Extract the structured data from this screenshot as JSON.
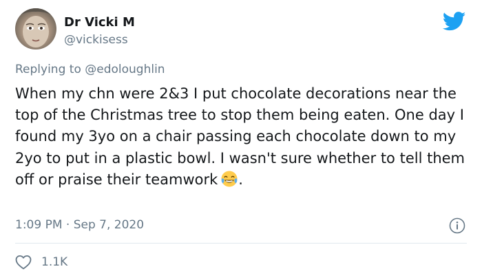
{
  "author": {
    "display_name": "Dr Vicki M",
    "handle": "@vickisess"
  },
  "reply": {
    "prefix": "Replying to ",
    "mention": "@edoloughlin"
  },
  "tweet": {
    "text": "When my chn were 2&3 I put chocolate decorations near the top of the Christmas tree to stop them being eaten. One day I found my 3yo on a chair passing each chocolate down to my 2yo to put in a plastic bowl. I wasn't sure whether to tell them off or praise their teamwork",
    "trailing_text": ".",
    "emoji": "tears-of-joy-emoji"
  },
  "meta": {
    "timestamp": "1:09 PM · Sep 7, 2020",
    "like_count": "1.1K"
  },
  "icons": {
    "brand": "twitter-bird-icon",
    "info": "info-icon",
    "like": "heart-icon"
  },
  "colors": {
    "brand": "#1DA1F2",
    "secondary_text": "#657786",
    "divider": "#E1E8ED"
  }
}
